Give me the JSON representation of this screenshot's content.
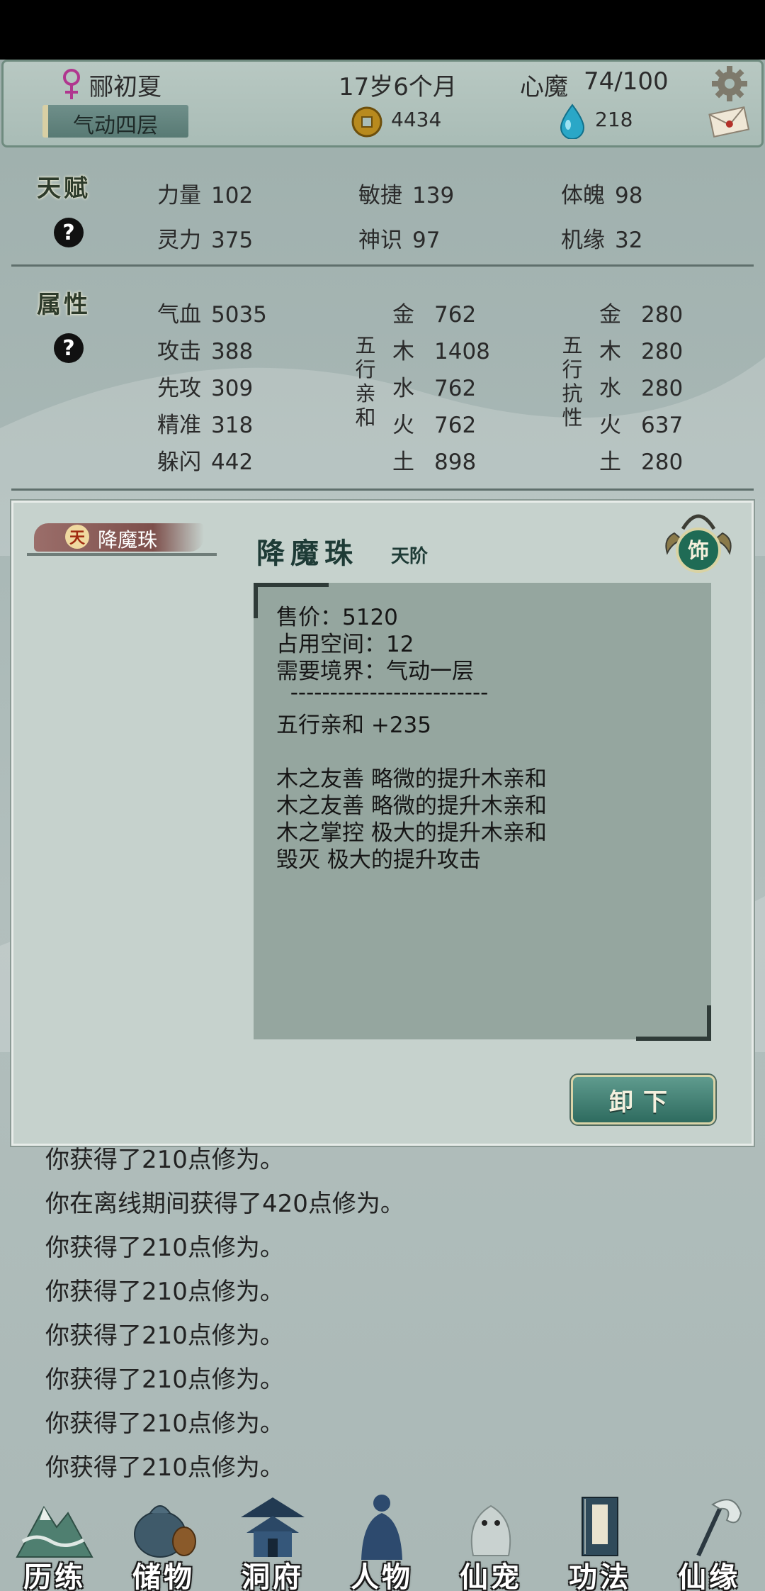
{
  "header": {
    "name": "郦初夏",
    "age": "17岁6个月",
    "inner_demon_label": "心魔",
    "inner_demon_value": "74/100",
    "realm": "气动四层",
    "coins": "4434",
    "spirit_stones": "218"
  },
  "talent": {
    "title": "天赋",
    "help": "?",
    "stats": [
      {
        "label": "力量",
        "value": "102"
      },
      {
        "label": "敏捷",
        "value": "139"
      },
      {
        "label": "体魄",
        "value": "98"
      },
      {
        "label": "灵力",
        "value": "375"
      },
      {
        "label": "神识",
        "value": "97"
      },
      {
        "label": "机缘",
        "value": "32"
      }
    ]
  },
  "attributes": {
    "title": "属性",
    "help": "?",
    "base": [
      {
        "label": "气血",
        "value": "5035"
      },
      {
        "label": "攻击",
        "value": "388"
      },
      {
        "label": "先攻",
        "value": "309"
      },
      {
        "label": "精准",
        "value": "318"
      },
      {
        "label": "躲闪",
        "value": "442"
      }
    ],
    "affinity_label": [
      "五",
      "行",
      "亲",
      "和"
    ],
    "affinity": [
      {
        "label": "金",
        "value": "762"
      },
      {
        "label": "木",
        "value": "1408"
      },
      {
        "label": "水",
        "value": "762"
      },
      {
        "label": "火",
        "value": "762"
      },
      {
        "label": "土",
        "value": "898"
      }
    ],
    "resist_label": [
      "五",
      "行",
      "抗",
      "性"
    ],
    "resist": [
      {
        "label": "金",
        "value": "280"
      },
      {
        "label": "木",
        "value": "280"
      },
      {
        "label": "水",
        "value": "280"
      },
      {
        "label": "火",
        "value": "637"
      },
      {
        "label": "土",
        "value": "280"
      }
    ]
  },
  "modal": {
    "tag_badge": "天",
    "tag_label": "降魔珠",
    "item_name": "降魔珠",
    "item_grade": "天阶",
    "slot_label": "饰",
    "details": [
      "售价：5120",
      "占用空间：12",
      "需要境界：气动一层",
      "  -------------------------",
      "五行亲和 +235",
      "",
      "木之友善 略微的提升木亲和",
      "木之友善 略微的提升木亲和",
      "木之掌控 极大的提升木亲和",
      "毁灭 极大的提升攻击"
    ],
    "unequip_label": "卸下"
  },
  "log": [
    "你获得了210点修为。",
    "你在离线期间获得了420点修为。",
    "你获得了210点修为。",
    "你获得了210点修为。",
    "你获得了210点修为。",
    "你获得了210点修为。",
    "你获得了210点修为。",
    "你获得了210点修为。"
  ],
  "nav": [
    {
      "label": "历练",
      "icon": "mountain-icon"
    },
    {
      "label": "储物",
      "icon": "bag-icon"
    },
    {
      "label": "洞府",
      "icon": "pavilion-icon"
    },
    {
      "label": "人物",
      "icon": "character-icon"
    },
    {
      "label": "仙宠",
      "icon": "pet-icon"
    },
    {
      "label": "功法",
      "icon": "book-icon"
    },
    {
      "label": "仙缘",
      "icon": "fate-icon"
    }
  ],
  "colors": {
    "accent": "#2e6b5f",
    "panel": "#c6d2cd",
    "detail_bg": "#95a69f",
    "tag": "#7d4f4b"
  }
}
